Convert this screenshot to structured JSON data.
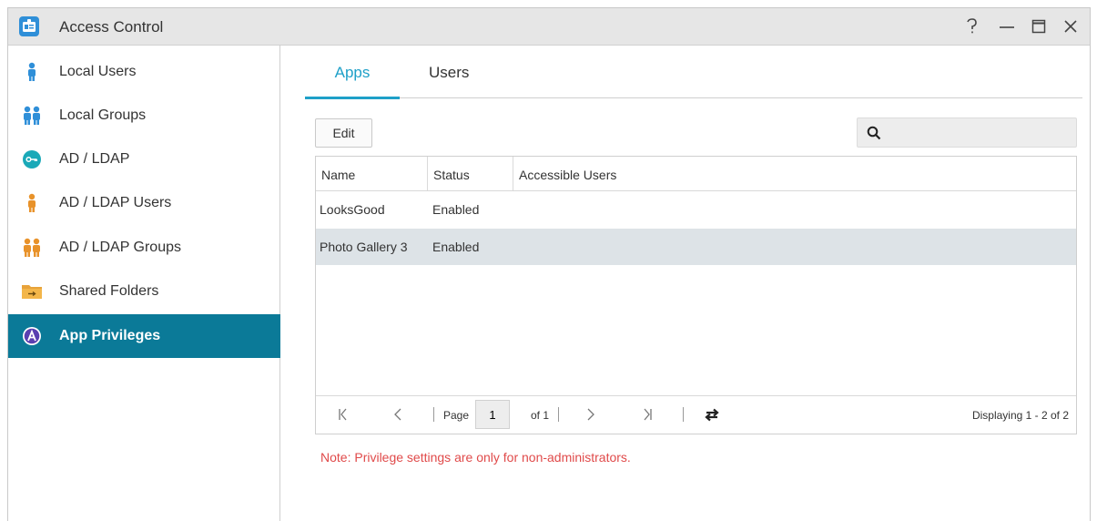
{
  "window": {
    "title": "Access Control",
    "controls": {
      "help": "help",
      "minimize": "minimize",
      "maximize": "maximize",
      "close": "close"
    }
  },
  "sidebar": {
    "items": [
      {
        "label": "Local Users",
        "icon": "user-icon",
        "active": false
      },
      {
        "label": "Local Groups",
        "icon": "group-icon",
        "active": false
      },
      {
        "label": "AD / LDAP",
        "icon": "key-icon",
        "active": false
      },
      {
        "label": "AD / LDAP Users",
        "icon": "ldap-user-icon",
        "active": false
      },
      {
        "label": "AD / LDAP Groups",
        "icon": "ldap-group-icon",
        "active": false
      },
      {
        "label": "Shared Folders",
        "icon": "folder-icon",
        "active": false
      },
      {
        "label": "App Privileges",
        "icon": "app-privileges-icon",
        "active": true
      }
    ]
  },
  "tabs": {
    "apps": "Apps",
    "users": "Users",
    "active": "Apps"
  },
  "toolbar": {
    "edit_label": "Edit",
    "search_placeholder": "",
    "search_value": ""
  },
  "table": {
    "columns": [
      "Name",
      "Status",
      "Accessible Users"
    ],
    "rows": [
      {
        "name": "LooksGood",
        "status": "Enabled",
        "users": "",
        "selected": false
      },
      {
        "name": "Photo Gallery 3",
        "status": "Enabled",
        "users": "",
        "selected": true
      }
    ]
  },
  "pager": {
    "page_label": "Page",
    "page_value": "1",
    "of_label": "of 1",
    "displaying": "Displaying 1 - 2 of 2"
  },
  "note": "Note: Privilege settings are only for non-administrators.",
  "colors": {
    "accent": "#1ea0c8",
    "sidebar_active": "#0b7a98",
    "note_red": "#e04a4a",
    "user_blue": "#2f8fd8",
    "user_orange": "#e8922a"
  }
}
